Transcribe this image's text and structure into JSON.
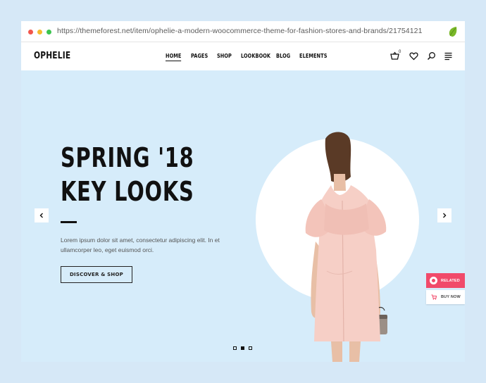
{
  "browser": {
    "url": "https://themeforest.net/item/ophelie-a-modern-woocommerce-theme-for-fashion-stores-and-brands/21754121",
    "controls": [
      "close",
      "minimize",
      "maximize"
    ],
    "extension_icon": "leaf-icon"
  },
  "header": {
    "logo": "OPHELIE",
    "nav": [
      {
        "label": "HOME",
        "active": true
      },
      {
        "label": "PAGES",
        "active": false
      },
      {
        "label": "SHOP",
        "active": false
      },
      {
        "label": "LOOKBOOK",
        "active": false
      },
      {
        "label": "BLOG",
        "active": false
      },
      {
        "label": "ELEMENTS",
        "active": false
      }
    ],
    "cart_count": "0",
    "icons": [
      "cart-icon",
      "heart-icon",
      "search-icon",
      "menu-icon"
    ]
  },
  "hero": {
    "title_line1": "SPRING '18",
    "title_line2": "KEY LOOKS",
    "description": "Lorem ipsum dolor sit amet, consectetur adipiscing elit. In et ullamcorper leo, eget euismod orci.",
    "button": "DISCOVER & SHOP",
    "slides_total": 3,
    "slide_active": 2
  },
  "side_buttons": {
    "related": "RELATED",
    "buy_now": "BUY NOW"
  },
  "colors": {
    "hero_bg": "#d6ecfa",
    "related_bg": "#f14a6a",
    "text": "#111111"
  }
}
